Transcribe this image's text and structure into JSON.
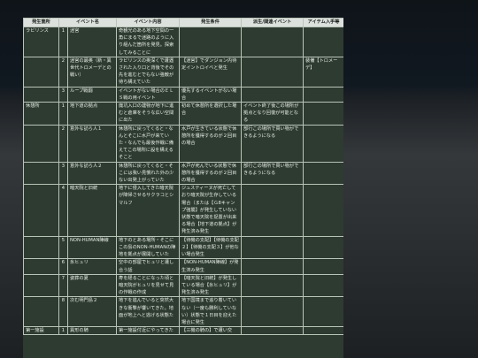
{
  "headers": [
    "発生箇所",
    "イベント名",
    "イベント内容",
    "発生条件",
    "派生/関連イベント",
    "アイテム入手等"
  ],
  "rows": [
    {
      "loc": "ラビリンス",
      "num": "1",
      "name": "迷宮",
      "content": "奇観光のある地下空間の一角にまるで迷路のように入り組んだ箇所を発見。探索してみることに",
      "cond": "",
      "related": "",
      "item": ""
    },
    {
      "loc": "",
      "num": "2",
      "name": "迷宮の最奥（新・異世代トロメーデとの戦い）",
      "content": "ラビリンスの奥深くで遭遇された入り口と背後でその先を進むとでもない強敵が待ち構えていた",
      "cond": "【迷宮】でダンジョン内待定イントロイベと発生",
      "related": "",
      "item": "装備【トロメーデ】"
    },
    {
      "loc": "",
      "num": "3",
      "name": "ループ戦闘",
      "content": "イベントがない場合のＥＬＳ戦の用イベント",
      "cond": "優先するイベントがない場合",
      "related": "",
      "item": ""
    },
    {
      "loc": "休憩所",
      "num": "1",
      "name": "地下道の拠点",
      "content": "廃坑入口の建物が地下に進むと倉庫をそうな広い空間に出た",
      "cond": "初めて休憩所を選択した場合",
      "related": "イベント終了後この場所が拠点となり回復が可能となる",
      "item": ""
    },
    {
      "loc": "",
      "num": "2",
      "name": "意外な訪ら人１",
      "content": "休憩所に戻ってくると・なんとそこに水戸が来ていた・なんでも最後作戦に備えてこの場所に設を構えるそこと",
      "cond": "水戸が生きている状態で休憩所を獲得するのが２回目の場合",
      "related": "部行この場所で買い物ができるようになる",
      "item": ""
    },
    {
      "loc": "",
      "num": "3",
      "name": "意外な訪ら人２",
      "content": "休憩所に戻ってくると・そこには我い見慣れた外の少ない出発上がっていた",
      "cond": "水戸が死んでいる状態で休憩所を獲得するのが２回目の場合",
      "related": "部行この場所で買い物ができるようになる",
      "item": ""
    },
    {
      "loc": "",
      "num": "4",
      "name": "暗天院と旧統",
      "content": "地下に侵入してきた暗天院が降帰させるサクラコとシマルフ",
      "cond": "ジュスティーヌが死亡しており暗天院が生存している場合（または【Ｇ8キャンプ強襲】が発生していない状態で暗天院を捉置が出来る場合【地下道の拠点】が発生済み発生",
      "related": "",
      "item": ""
    },
    {
      "loc": "",
      "num": "5",
      "name": "NON-HUMAN陣線",
      "content": "地下のとある場所・そこにこの島のNON-HUMANの陣地を拠点が展開していた",
      "cond": "【待機の支配】【待機の支配２】【待機の支配３】が他ない場合発生",
      "related": "",
      "item": ""
    },
    {
      "loc": "",
      "num": "6",
      "name": "氷ヒュリ",
      "content": "空中の部屋でヒュリと遭し合う話",
      "cond": "【NON-HUMAN陣線】が発生済み発生",
      "related": "",
      "item": ""
    },
    {
      "loc": "",
      "num": "7",
      "name": "姿葬の夏",
      "content": "寿を経ることになった頃と暗天院がヒュリを見せて見の作戦の作成",
      "cond": "【暗天院と旧統】が発生している場合【氷ヒュリ】が発生済み発生",
      "related": "",
      "item": ""
    },
    {
      "loc": "",
      "num": "8",
      "name": "次む明門島２",
      "content": "地下を進んでいると突然大きな衝撃が響いてきた。地面が地上へと逃げる状態た",
      "cond": "地下国境まで追り着いていない（一度も勝利していない）状態で１日目を迎えた場合に発生",
      "related": "",
      "item": ""
    },
    {
      "loc": "第一施設",
      "num": "1",
      "name": "異形の騎",
      "content": "第一施設付近にやってきた",
      "cond": "【三機の騎の】で遭い交",
      "related": "",
      "item": ""
    }
  ]
}
